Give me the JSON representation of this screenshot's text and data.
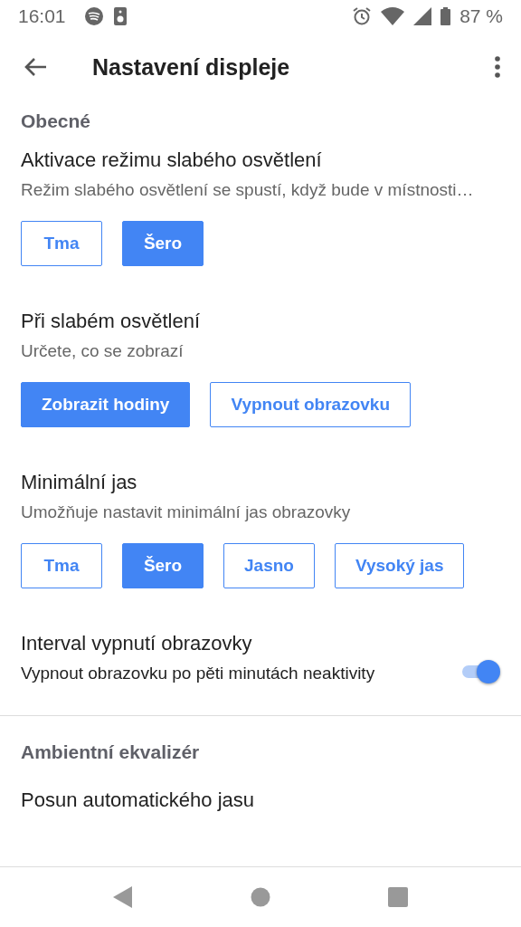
{
  "status_bar": {
    "time": "16:01",
    "battery": "87 %"
  },
  "app_bar": {
    "title": "Nastavení displeje"
  },
  "sections": [
    {
      "kind": "options",
      "header": "Obecné",
      "title": "Aktivace režimu slabého osvětlení",
      "description": "Režim slabého osvětlení se spustí, když bude v místnosti…",
      "options": [
        {
          "label": "Tma",
          "selected": false
        },
        {
          "label": "Šero",
          "selected": true
        }
      ]
    },
    {
      "kind": "options",
      "title": "Při slabém osvětlení",
      "description": "Určete, co se zobrazí",
      "options": [
        {
          "label": "Zobrazit hodiny",
          "selected": true
        },
        {
          "label": "Vypnout obrazovku",
          "selected": false
        }
      ]
    },
    {
      "kind": "options",
      "title": "Minimální jas",
      "description": "Umožňuje nastavit minimální jas obrazovky",
      "options": [
        {
          "label": "Tma",
          "selected": false
        },
        {
          "label": "Šero",
          "selected": true
        },
        {
          "label": "Jasno",
          "selected": false
        },
        {
          "label": "Vysoký jas",
          "selected": false
        }
      ]
    },
    {
      "kind": "switch",
      "title": "Interval vypnutí obrazovky",
      "description": "Vypnout obrazovku po pěti minutách neaktivity",
      "on": true
    }
  ],
  "section_2": {
    "header": "Ambientní ekvalizér",
    "items": [
      "Posun automatického jasu"
    ]
  }
}
